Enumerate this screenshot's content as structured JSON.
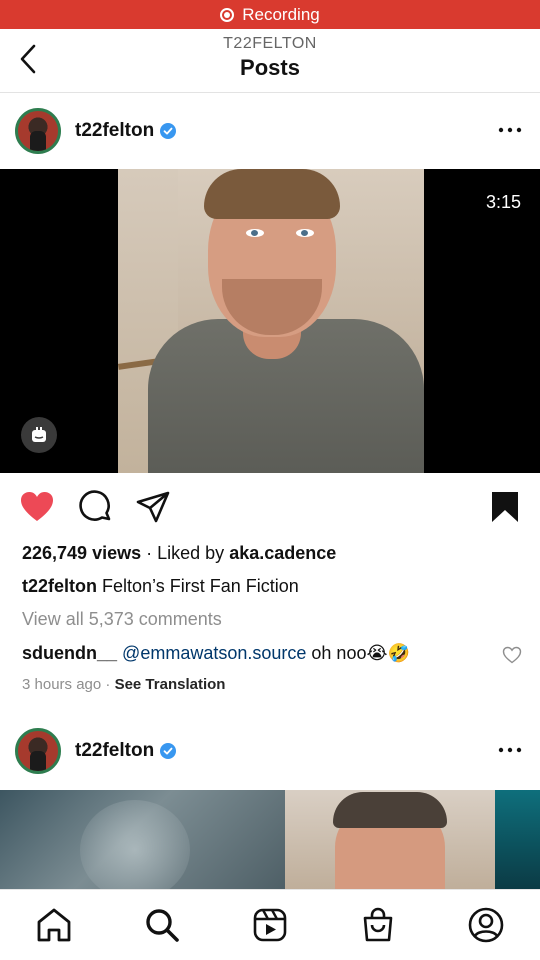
{
  "recording": {
    "label": "Recording"
  },
  "nav": {
    "subtitle": "T22FELTON",
    "title": "Posts"
  },
  "post1": {
    "username": "t22felton",
    "duration": "3:15",
    "views": "226,749 views",
    "liked_by_prefix": "Liked by",
    "liked_by_user": "aka.cadence",
    "caption_user": "t22felton",
    "caption_text": "Felton’s First Fan Fiction",
    "view_comments": "View all 5,373 comments",
    "comment": {
      "user": "sduendn__",
      "mention": "@emmawatson.source",
      "text": "oh noo😭🤣"
    },
    "time_ago": "3 hours ago",
    "see_translation": "See Translation"
  },
  "post2": {
    "username": "t22felton"
  },
  "colors": {
    "recording_bar": "#d93a2f",
    "like_red": "#ed4956",
    "verified_blue": "#3897f0",
    "mention": "#00376b",
    "avatar_ring": "#2e7d4f"
  },
  "icons": {
    "back": "chevron-left-icon",
    "more": "more-horizontal-icon",
    "like": "heart-filled-icon",
    "comment": "comment-icon",
    "share": "send-icon",
    "save": "bookmark-filled-icon",
    "tabs": [
      "home-icon",
      "search-icon",
      "reels-icon",
      "shop-icon",
      "profile-icon"
    ]
  }
}
